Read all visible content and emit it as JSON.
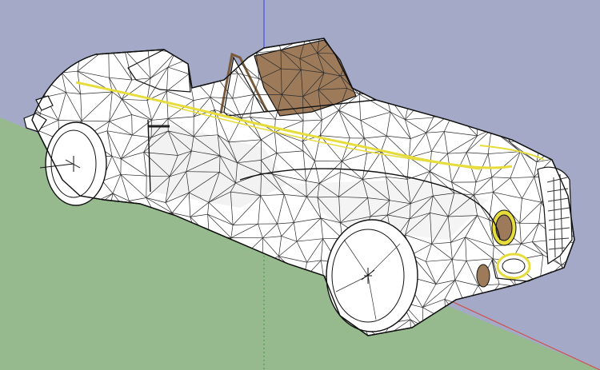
{
  "scene": {
    "sky_color": "#a3a9c6",
    "ground_color": "#96ba8d",
    "body_color": "#ffffff",
    "edge_color": "#111111",
    "trim_color": "#e6dc3c",
    "leather_color": "#9c7a5a",
    "axis_colors": {
      "blue": "#4a4af0",
      "red": "#d0504c",
      "green": "#3c9c3c"
    }
  },
  "model": {
    "name": "convertible-car",
    "style": "triangulated-wireframe",
    "mesh_line_count": 320,
    "wheels_visible": 2,
    "headlight_rings": 2
  }
}
